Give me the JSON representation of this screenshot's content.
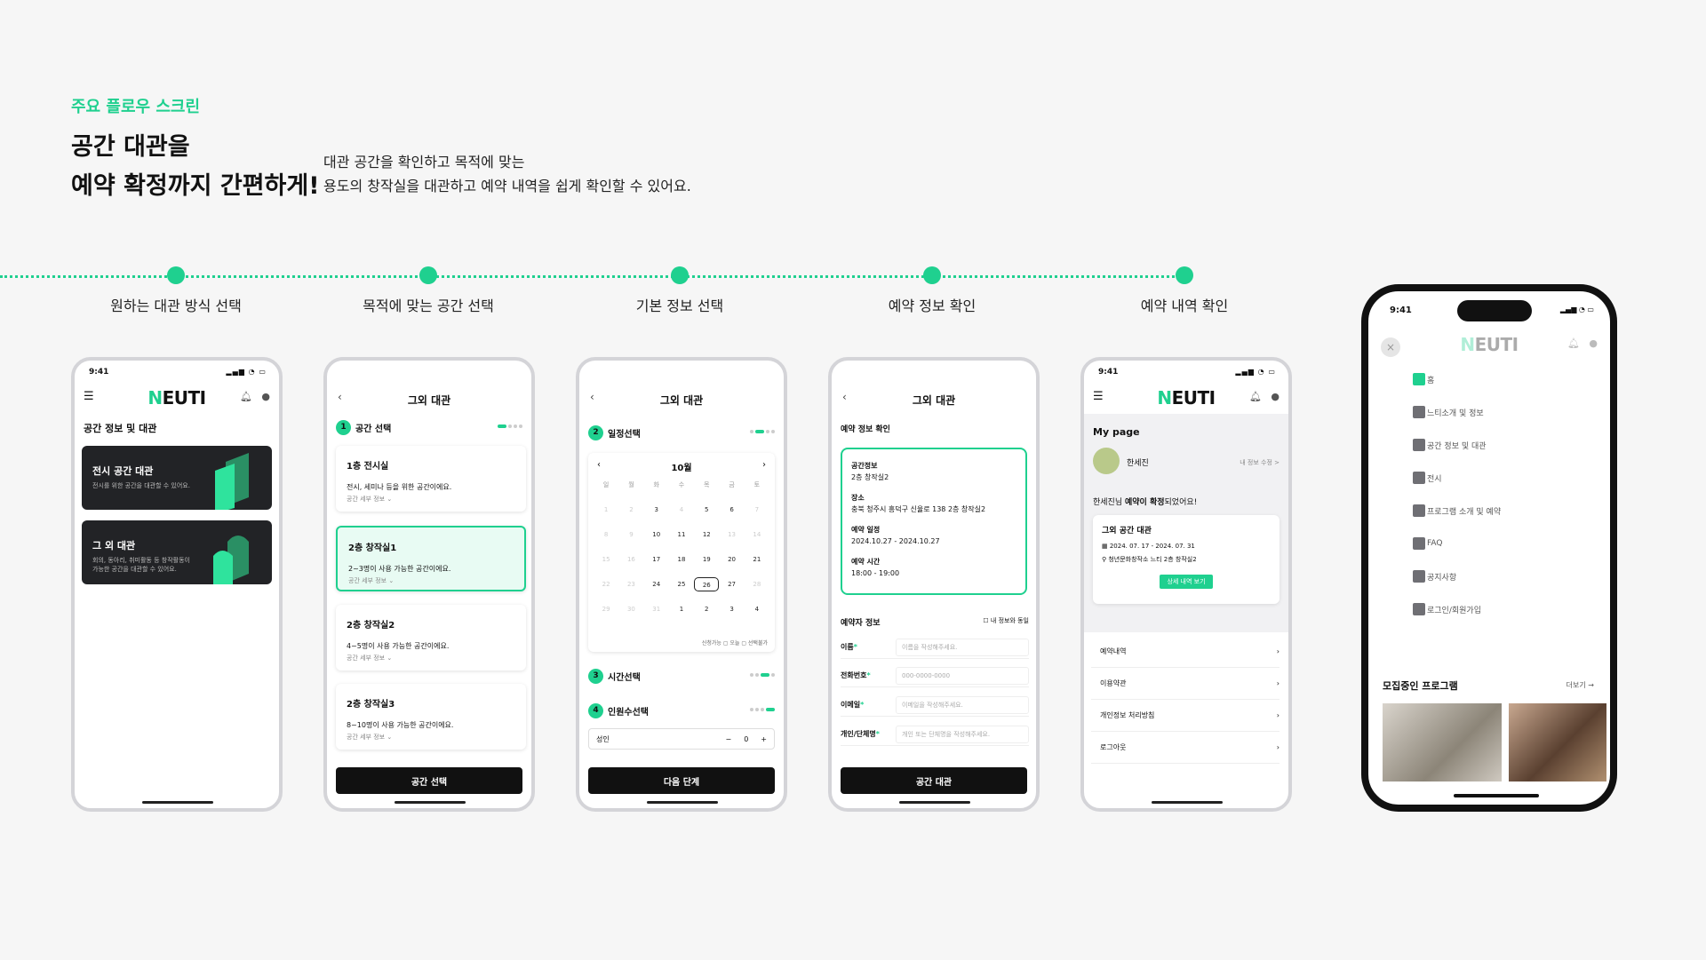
{
  "header": {
    "eyebrow": "주요 플로우 스크린",
    "headline_line1": "공간 대관을",
    "headline_line2": "예약 확정까지 간편하게!",
    "desc_line1": "대관 공간을 확인하고 목적에 맞는",
    "desc_line2": "용도의 창작실을 대관하고 예약 내역을 쉽게 확인할 수 있어요."
  },
  "steps": [
    "원하는 대관 방식 선택",
    "목적에 맞는 공간 선택",
    "기본 정보 선택",
    "예약 정보 확인",
    "예약 내역 확인"
  ],
  "colors": {
    "accent": "#1fd08f",
    "dark": "#222326"
  },
  "status_time": "9:41",
  "logo": {
    "accent": "N",
    "rest": "EUTI"
  },
  "screen1": {
    "section_title": "공간 정보 및 대관",
    "card1_title": "전시 공간 대관",
    "card1_desc": "전시를 위한 공간을 대관할 수 있어요.",
    "card2_title": "그 외 대관",
    "card2_desc_1": "회의, 동아리, 취미활동 등 창작활동이",
    "card2_desc_2": "가능한 공간을 대관할 수 있어요."
  },
  "screen2": {
    "title": "그외 대관",
    "step_title": "공간 선택",
    "step_num": "1",
    "detail_label": "공간 세부 정보",
    "cards": [
      {
        "title": "1층 전시실",
        "desc": "전시, 세미나 등을 위한 공간이에요."
      },
      {
        "title": "2층 창작실1",
        "desc": "2~3명이 사용 가능한 공간이에요."
      },
      {
        "title": "2층 창작실2",
        "desc": "4~5명이 사용 가능한 공간이에요."
      },
      {
        "title": "2층 창작실3",
        "desc": "8~10명이 사용 가능한 공간이에요."
      }
    ],
    "button": "공간 선택"
  },
  "screen3": {
    "title": "그외 대관",
    "step2_num": "2",
    "step2": "일정선택",
    "month": "10월",
    "weekdays": [
      "일",
      "월",
      "화",
      "수",
      "목",
      "금",
      "토"
    ],
    "weeks": [
      [
        "1",
        "2",
        "3",
        "4",
        "5",
        "6",
        "7"
      ],
      [
        "8",
        "9",
        "10",
        "11",
        "12",
        "13",
        "14"
      ],
      [
        "15",
        "16",
        "17",
        "18",
        "19",
        "20",
        "21"
      ],
      [
        "22",
        "23",
        "24",
        "25",
        "26",
        "27",
        "28"
      ],
      [
        "29",
        "30",
        "31",
        "1",
        "2",
        "3",
        "4"
      ]
    ],
    "legend": "신청가능 ▢ 오늘 ▢ 선택불가",
    "step3_num": "3",
    "step3": "시간선택",
    "step4_num": "4",
    "step4": "인원수선택",
    "person_label": "성인",
    "person_count": "0",
    "button": "다음 단계"
  },
  "screen4": {
    "title": "그외 대관",
    "section_title": "예약 정보 확인",
    "info": [
      {
        "label": "공간정보",
        "value": "2층 창작실2"
      },
      {
        "label": "장소",
        "value": "충북 청주시 흥덕구 신율로 138 2층 창작실2"
      },
      {
        "label": "예약 일정",
        "value": "2024.10.27 - 2024.10.27"
      },
      {
        "label": "예약 시간",
        "value": "18:00 - 19:00"
      }
    ],
    "booker_title": "예약자 정보",
    "same_info": "내 정보와 동일",
    "fields": [
      {
        "label": "이름",
        "placeholder": "이름을 작성해주세요."
      },
      {
        "label": "전화번호",
        "placeholder": "000-0000-0000"
      },
      {
        "label": "이메일",
        "placeholder": "이메일을 작성해주세요."
      },
      {
        "label": "개인/단체명",
        "placeholder": "개인 또는 단체명을 작성해주세요."
      }
    ],
    "button": "공간 대관"
  },
  "screen5": {
    "mypage": "My page",
    "user_name": "한세진",
    "edit_link": "내 정보 수정 >",
    "confirm_prefix": "한세진님 ",
    "confirm_bold": "예약이 확정",
    "confirm_suffix": "되었어요!",
    "card_title": "그외 공간 대관",
    "card_date": "2024. 07. 17 - 2024. 07. 31",
    "card_place": "청년문화창작소 느티 2층 창작실2",
    "card_button": "상세 내역 보기",
    "menu": [
      "예약내역",
      "이용약관",
      "개인정보 처리방침",
      "로그아웃"
    ]
  },
  "side_menu": {
    "items": [
      "홈",
      "느티소개 및 정보",
      "공간 정보 및 대관",
      "전시",
      "프로그램 소개 및 예약",
      "FAQ",
      "공지사항",
      "로그인/회원가입"
    ],
    "section": "모집중인 프로그램",
    "more": "더보기 →"
  }
}
